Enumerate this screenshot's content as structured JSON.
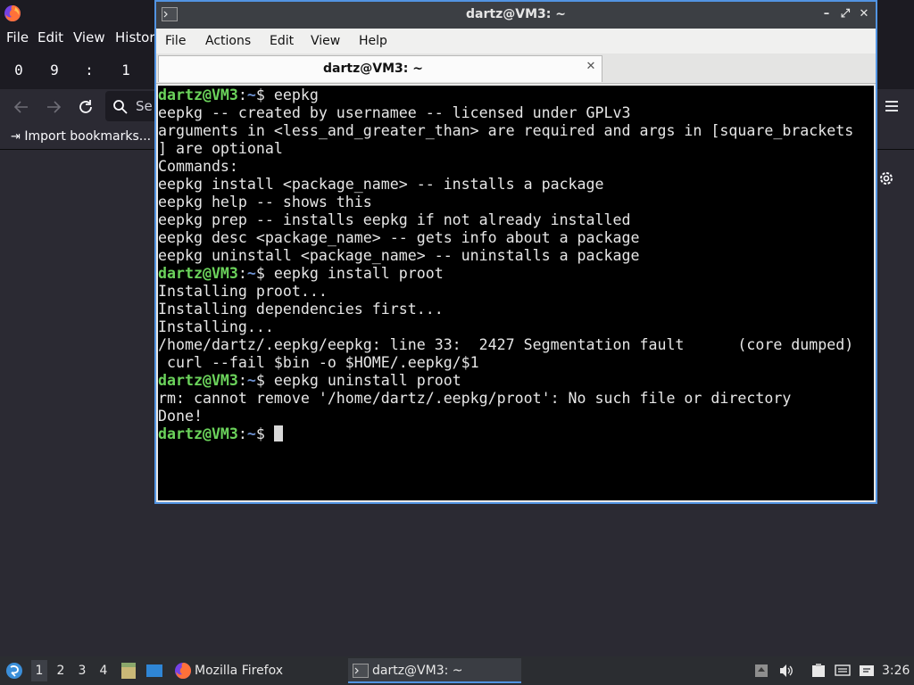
{
  "firefox": {
    "menu": [
      "File",
      "Edit",
      "View",
      "History"
    ],
    "clock_digits": [
      "0",
      "9",
      ":",
      "1"
    ],
    "search_placeholder": "Se",
    "import_bookmarks": "Import bookmarks..."
  },
  "terminal": {
    "title": "dartz@VM3: ~",
    "menu": [
      "File",
      "Actions",
      "Edit",
      "View",
      "Help"
    ],
    "tab_label": "dartz@VM3: ~",
    "prompt": {
      "user": "dartz@VM3",
      "sep": ":",
      "path": "~",
      "sym": "$"
    },
    "lines": [
      {
        "type": "prompt",
        "cmd": " eepkg"
      },
      {
        "type": "out",
        "text": "eepkg -- created by usernamee -- licensed under GPLv3"
      },
      {
        "type": "out",
        "text": "arguments in <less_and_greater_than> are required and args in [square_brackets"
      },
      {
        "type": "out",
        "text": "] are optional"
      },
      {
        "type": "out",
        "text": "Commands:"
      },
      {
        "type": "out",
        "text": "eepkg install <package_name> -- installs a package"
      },
      {
        "type": "out",
        "text": "eepkg help -- shows this"
      },
      {
        "type": "out",
        "text": "eepkg prep -- installs eepkg if not already installed"
      },
      {
        "type": "out",
        "text": "eepkg desc <package_name> -- gets info about a package"
      },
      {
        "type": "out",
        "text": "eepkg uninstall <package_name> -- uninstalls a package"
      },
      {
        "type": "prompt",
        "cmd": " eepkg install proot"
      },
      {
        "type": "out",
        "text": "Installing proot..."
      },
      {
        "type": "out",
        "text": "Installing dependencies first..."
      },
      {
        "type": "out",
        "text": "Installing..."
      },
      {
        "type": "out",
        "text": "/home/dartz/.eepkg/eepkg: line 33:  2427 Segmentation fault      (core dumped)"
      },
      {
        "type": "out",
        "text": " curl --fail $bin -o $HOME/.eepkg/$1"
      },
      {
        "type": "prompt",
        "cmd": " eepkg uninstall proot"
      },
      {
        "type": "out",
        "text": "rm: cannot remove '/home/dartz/.eepkg/proot': No such file or directory"
      },
      {
        "type": "out",
        "text": "Done!"
      },
      {
        "type": "prompt",
        "cmd": " ",
        "cursor": true
      }
    ]
  },
  "taskbar": {
    "workspaces": [
      "1",
      "2",
      "3",
      "4"
    ],
    "active_workspace": "1",
    "tasks": [
      {
        "label": "Mozilla Firefox",
        "icon": "firefox-icon"
      },
      {
        "label": "dartz@VM3: ~",
        "icon": "terminal-icon"
      }
    ],
    "clock": "3:26"
  }
}
